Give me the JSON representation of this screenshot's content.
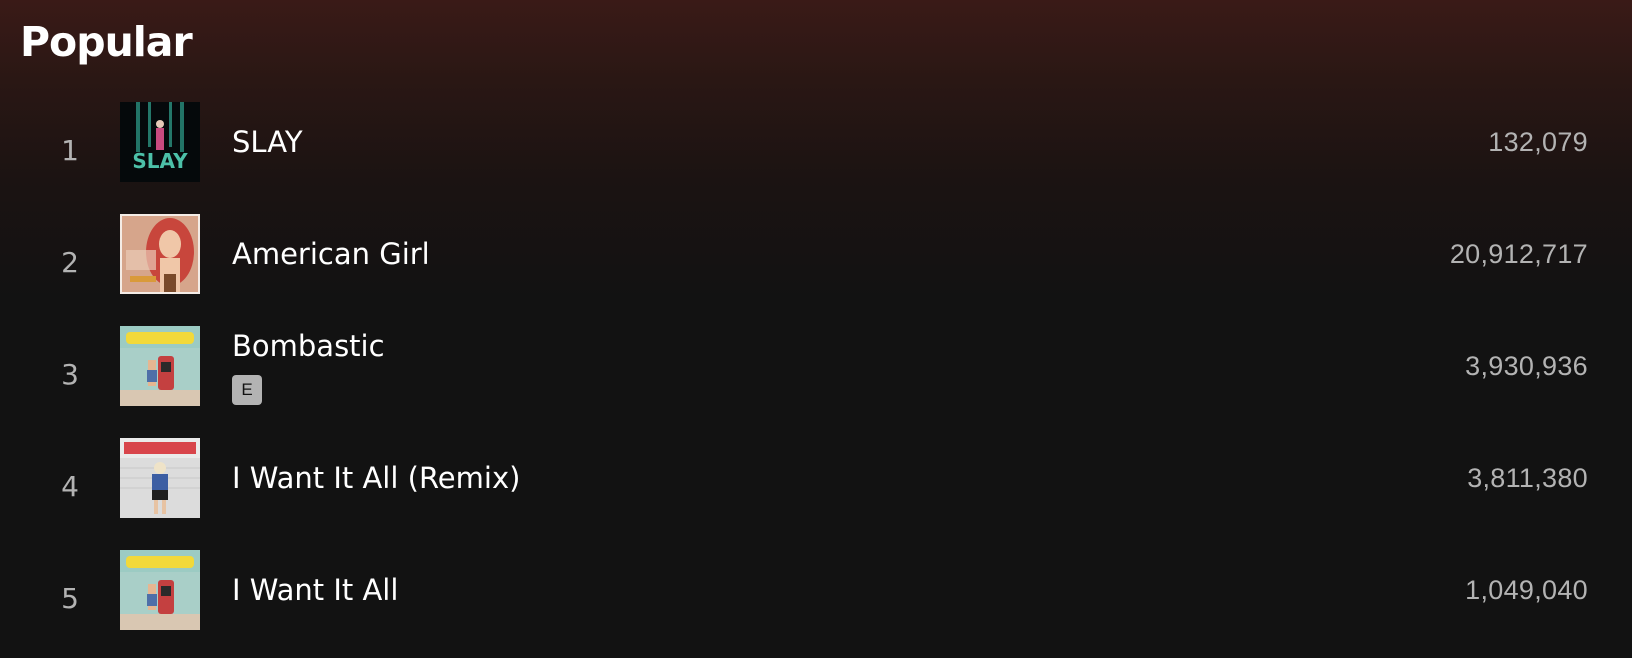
{
  "section": {
    "title": "Popular"
  },
  "tracks": [
    {
      "index": "1",
      "title": "SLAY",
      "plays": "132,079",
      "explicit": false,
      "cover": "slay-cover"
    },
    {
      "index": "2",
      "title": "American Girl",
      "plays": "20,912,717",
      "explicit": false,
      "cover": "american-girl-cover"
    },
    {
      "index": "3",
      "title": "Bombastic",
      "plays": "3,930,936",
      "explicit": true,
      "explicit_label": "E",
      "cover": "bombastic-cover"
    },
    {
      "index": "4",
      "title": "I Want It All (Remix)",
      "plays": "3,811,380",
      "explicit": false,
      "cover": "i-want-it-all-remix-cover"
    },
    {
      "index": "5",
      "title": "I Want It All",
      "plays": "1,049,040",
      "explicit": false,
      "cover": "bombastic-cover"
    }
  ],
  "colors": {
    "background": "#121212",
    "header_gradient_top": "#3a1a17",
    "text_primary": "#ffffff",
    "text_secondary": "#b3b3b3"
  }
}
